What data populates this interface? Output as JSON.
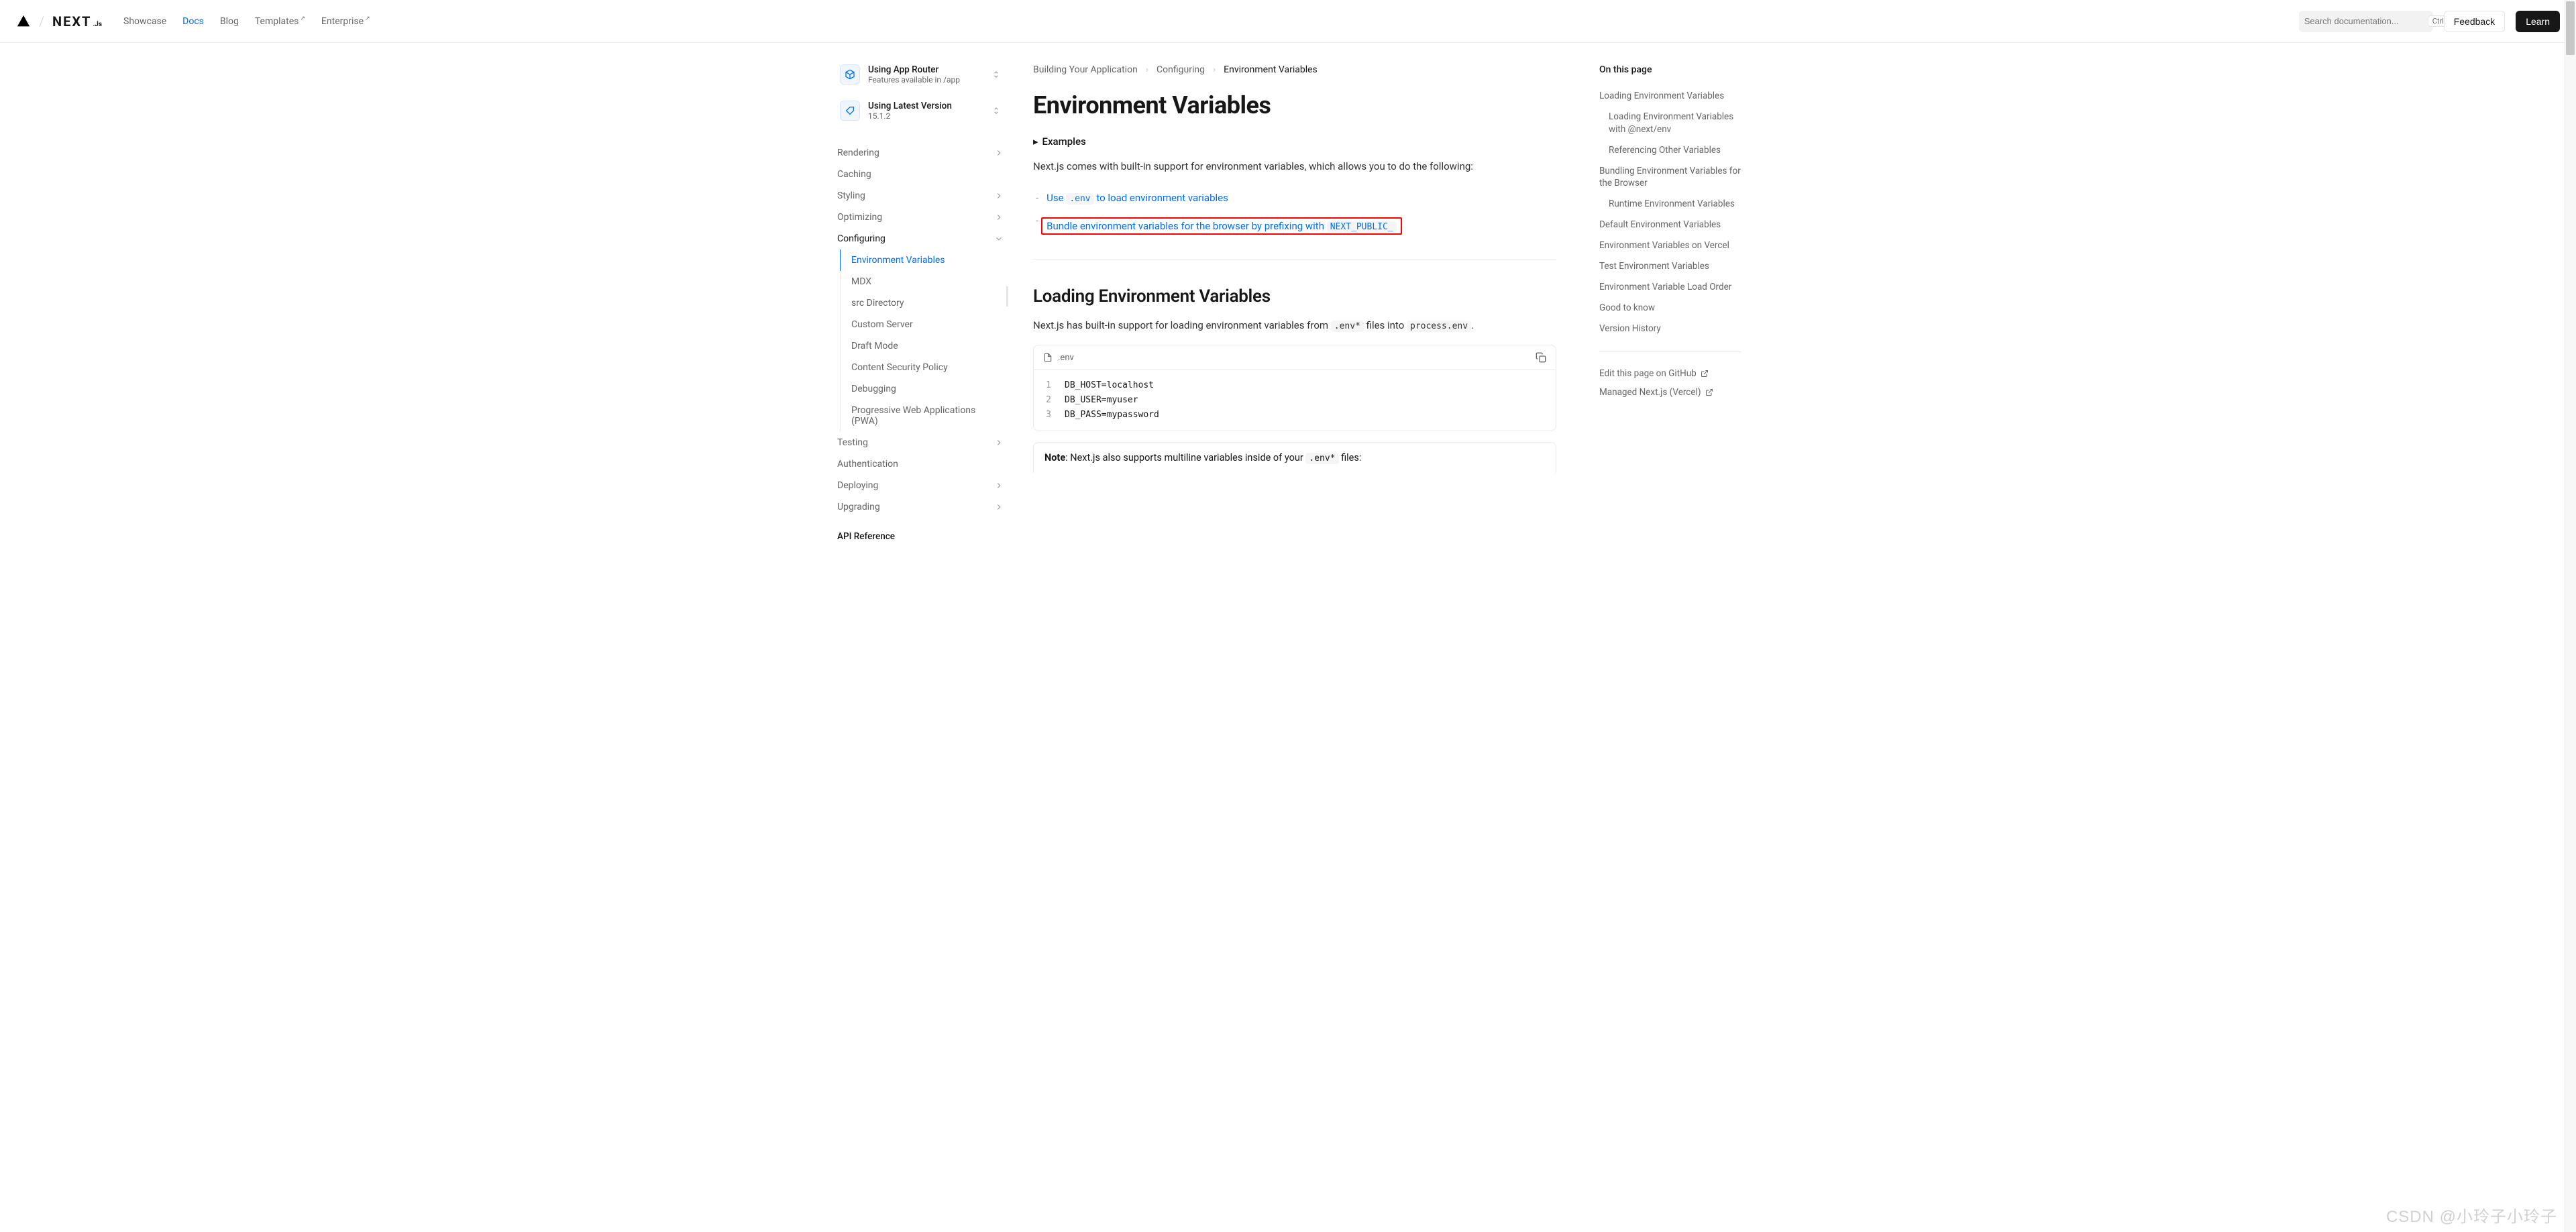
{
  "header": {
    "nav": [
      {
        "label": "Showcase",
        "active": false,
        "external": false
      },
      {
        "label": "Docs",
        "active": true,
        "external": false
      },
      {
        "label": "Blog",
        "active": false,
        "external": false
      },
      {
        "label": "Templates",
        "active": false,
        "external": true
      },
      {
        "label": "Enterprise",
        "active": false,
        "external": true
      }
    ],
    "search_placeholder": "Search documentation...",
    "search_kbd": "CtrlK",
    "feedback_label": "Feedback",
    "learn_label": "Learn"
  },
  "sidebar": {
    "selectors": [
      {
        "title": "Using App Router",
        "sub": "Features available in /app",
        "icon": "cube"
      },
      {
        "title": "Using Latest Version",
        "sub": "15.1.2",
        "icon": "tag"
      }
    ],
    "items": [
      {
        "label": "Rendering",
        "chev": true
      },
      {
        "label": "Caching",
        "chev": false
      },
      {
        "label": "Styling",
        "chev": true
      },
      {
        "label": "Optimizing",
        "chev": true
      },
      {
        "label": "Configuring",
        "chev": true,
        "expanded": true,
        "children": [
          {
            "label": "Environment Variables",
            "active": true
          },
          {
            "label": "MDX"
          },
          {
            "label": "src Directory"
          },
          {
            "label": "Custom Server"
          },
          {
            "label": "Draft Mode"
          },
          {
            "label": "Content Security Policy"
          },
          {
            "label": "Debugging"
          },
          {
            "label": "Progressive Web Applications (PWA)"
          }
        ]
      },
      {
        "label": "Testing",
        "chev": true
      },
      {
        "label": "Authentication",
        "chev": false
      },
      {
        "label": "Deploying",
        "chev": true
      },
      {
        "label": "Upgrading",
        "chev": true
      }
    ],
    "heading": "API Reference"
  },
  "main": {
    "breadcrumb": [
      "Building Your Application",
      "Configuring",
      "Environment Variables"
    ],
    "title": "Environment Variables",
    "examples_label": "Examples",
    "intro": "Next.js comes with built-in support for environment variables, which allows you to do the following:",
    "features": [
      {
        "pre": "Use ",
        "code": ".env",
        "post": " to load environment variables"
      },
      {
        "pre": "Bundle environment variables for the browser by prefixing with ",
        "code": "NEXT_PUBLIC_",
        "post": "",
        "highlighted": true
      }
    ],
    "h2_loading": "Loading Environment Variables",
    "loading_p_pre": "Next.js has built-in support for loading environment variables from ",
    "loading_p_code1": ".env*",
    "loading_p_mid": " files into ",
    "loading_p_code2": "process.env",
    "loading_p_post": ".",
    "code": {
      "filename": ".env",
      "lines": [
        "DB_HOST=localhost",
        "DB_USER=myuser",
        "DB_PASS=mypassword"
      ]
    },
    "note_pre": "Note",
    "note_mid": ": Next.js also supports multiline variables inside of your ",
    "note_code": ".env*",
    "note_post": " files:"
  },
  "toc": {
    "title": "On this page",
    "items": [
      {
        "label": "Loading Environment Variables"
      },
      {
        "label": "Loading Environment Variables with @next/env",
        "sub": true
      },
      {
        "label": "Referencing Other Variables",
        "sub": true
      },
      {
        "label": "Bundling Environment Variables for the Browser"
      },
      {
        "label": "Runtime Environment Variables",
        "sub": true
      },
      {
        "label": "Default Environment Variables"
      },
      {
        "label": "Environment Variables on Vercel"
      },
      {
        "label": "Test Environment Variables"
      },
      {
        "label": "Environment Variable Load Order"
      },
      {
        "label": "Good to know"
      },
      {
        "label": "Version History"
      }
    ],
    "links": [
      {
        "label": "Edit this page on GitHub"
      },
      {
        "label": "Managed Next.js (Vercel)"
      }
    ]
  },
  "watermark": "CSDN @小玲子小玲子"
}
